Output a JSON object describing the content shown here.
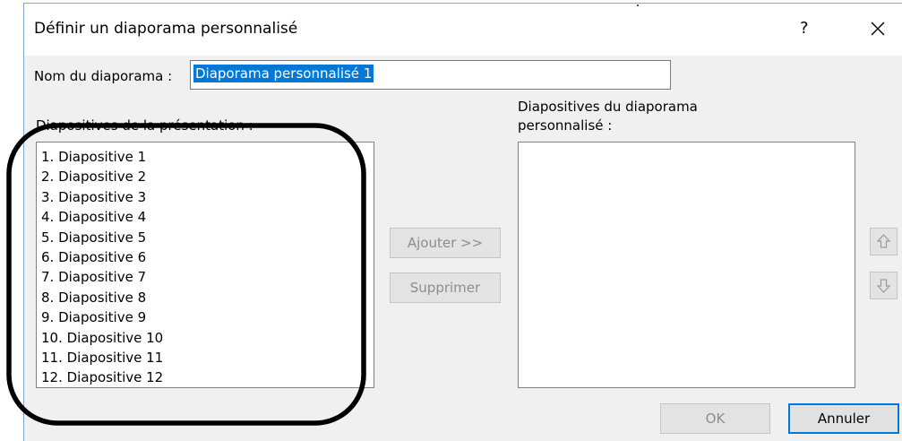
{
  "dialog": {
    "title": "Définir un diaporama personnalisé",
    "help_label": "?",
    "close_icon": "close-icon"
  },
  "name_field": {
    "label": "Nom du diaporama :",
    "value": "Diaporama personnalisé 1"
  },
  "slides_list": {
    "label": "Diapositives de la présentation :",
    "items": [
      "1. Diapositive 1",
      "2. Diapositive 2",
      "3. Diapositive 3",
      "4. Diapositive 4",
      "5. Diapositive 5",
      "6. Diapositive 6",
      "7. Diapositive 7",
      "8. Diapositive 8",
      "9. Diapositive 9",
      "10. Diapositive 10",
      "11. Diapositive 11",
      "12. Diapositive 12"
    ]
  },
  "custom_list": {
    "label_line1": "Diapositives du diaporama",
    "label_line2": "personnalisé :",
    "items": []
  },
  "buttons": {
    "add": "Ajouter >>",
    "remove": "Supprimer",
    "ok": "OK",
    "cancel": "Annuler",
    "move_up_icon": "arrow-up-icon",
    "move_down_icon": "arrow-down-icon"
  },
  "colors": {
    "dialog_bg": "#f0f0f0",
    "selection": "#0078d7",
    "disabled_text": "#8d8d8d",
    "annotation": "#000000"
  }
}
